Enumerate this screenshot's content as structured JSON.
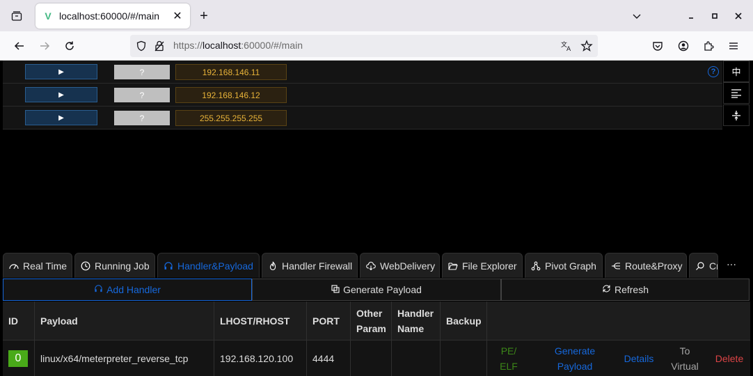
{
  "browser": {
    "tab_title": "localhost:60000/#/main",
    "url_scheme": "https://",
    "url_host": "localhost",
    "url_rest": ":60000/#/main"
  },
  "hosts": [
    {
      "expand": "▶",
      "os": "?",
      "ip": "192.168.146.11"
    },
    {
      "expand": "▶",
      "os": "?",
      "ip": "192.168.146.12"
    },
    {
      "expand": "▶",
      "os": "?",
      "ip": "255.255.255.255"
    }
  ],
  "side_tools": {
    "lang": "中"
  },
  "help": "?",
  "tabs": [
    {
      "label": "Real Time",
      "icon": "dashboard-icon"
    },
    {
      "label": "Running Job",
      "icon": "clock-icon"
    },
    {
      "label": "Handler&Payload",
      "icon": "headphones-icon"
    },
    {
      "label": "Handler Firewall",
      "icon": "fire-icon"
    },
    {
      "label": "WebDelivery",
      "icon": "cloud-download-icon"
    },
    {
      "label": "File Explorer",
      "icon": "folder-open-icon"
    },
    {
      "label": "Pivot Graph",
      "icon": "cluster-icon"
    },
    {
      "label": "Route&Proxy",
      "icon": "branches-icon"
    },
    {
      "label": "Cr",
      "icon": "search-icon"
    }
  ],
  "more": "···",
  "actions": {
    "add_handler": "Add Handler",
    "generate_payload": "Generate Payload",
    "refresh": "Refresh"
  },
  "table": {
    "headers": [
      "ID",
      "Payload",
      "LHOST/RHOST",
      "PORT",
      "Other\nParam",
      "Handler\nName",
      "Backup"
    ],
    "rows": [
      {
        "id": "0",
        "payload": "linux/x64/meterpreter_reverse_tcp",
        "lhost": "192.168.120.100",
        "port": "4444",
        "other_param": "",
        "handler_name": "",
        "backup": "",
        "actions": {
          "pe_elf": "PE/\nELF",
          "generate_payload": "Generate\nPayload",
          "details": "Details",
          "to_virtual": "To\nVirtual",
          "delete": "Delete"
        }
      }
    ]
  },
  "colors": {
    "primary": "#1668dc",
    "warning_text": "#e8b339",
    "success": "#49aa19",
    "danger": "#dc4446"
  }
}
